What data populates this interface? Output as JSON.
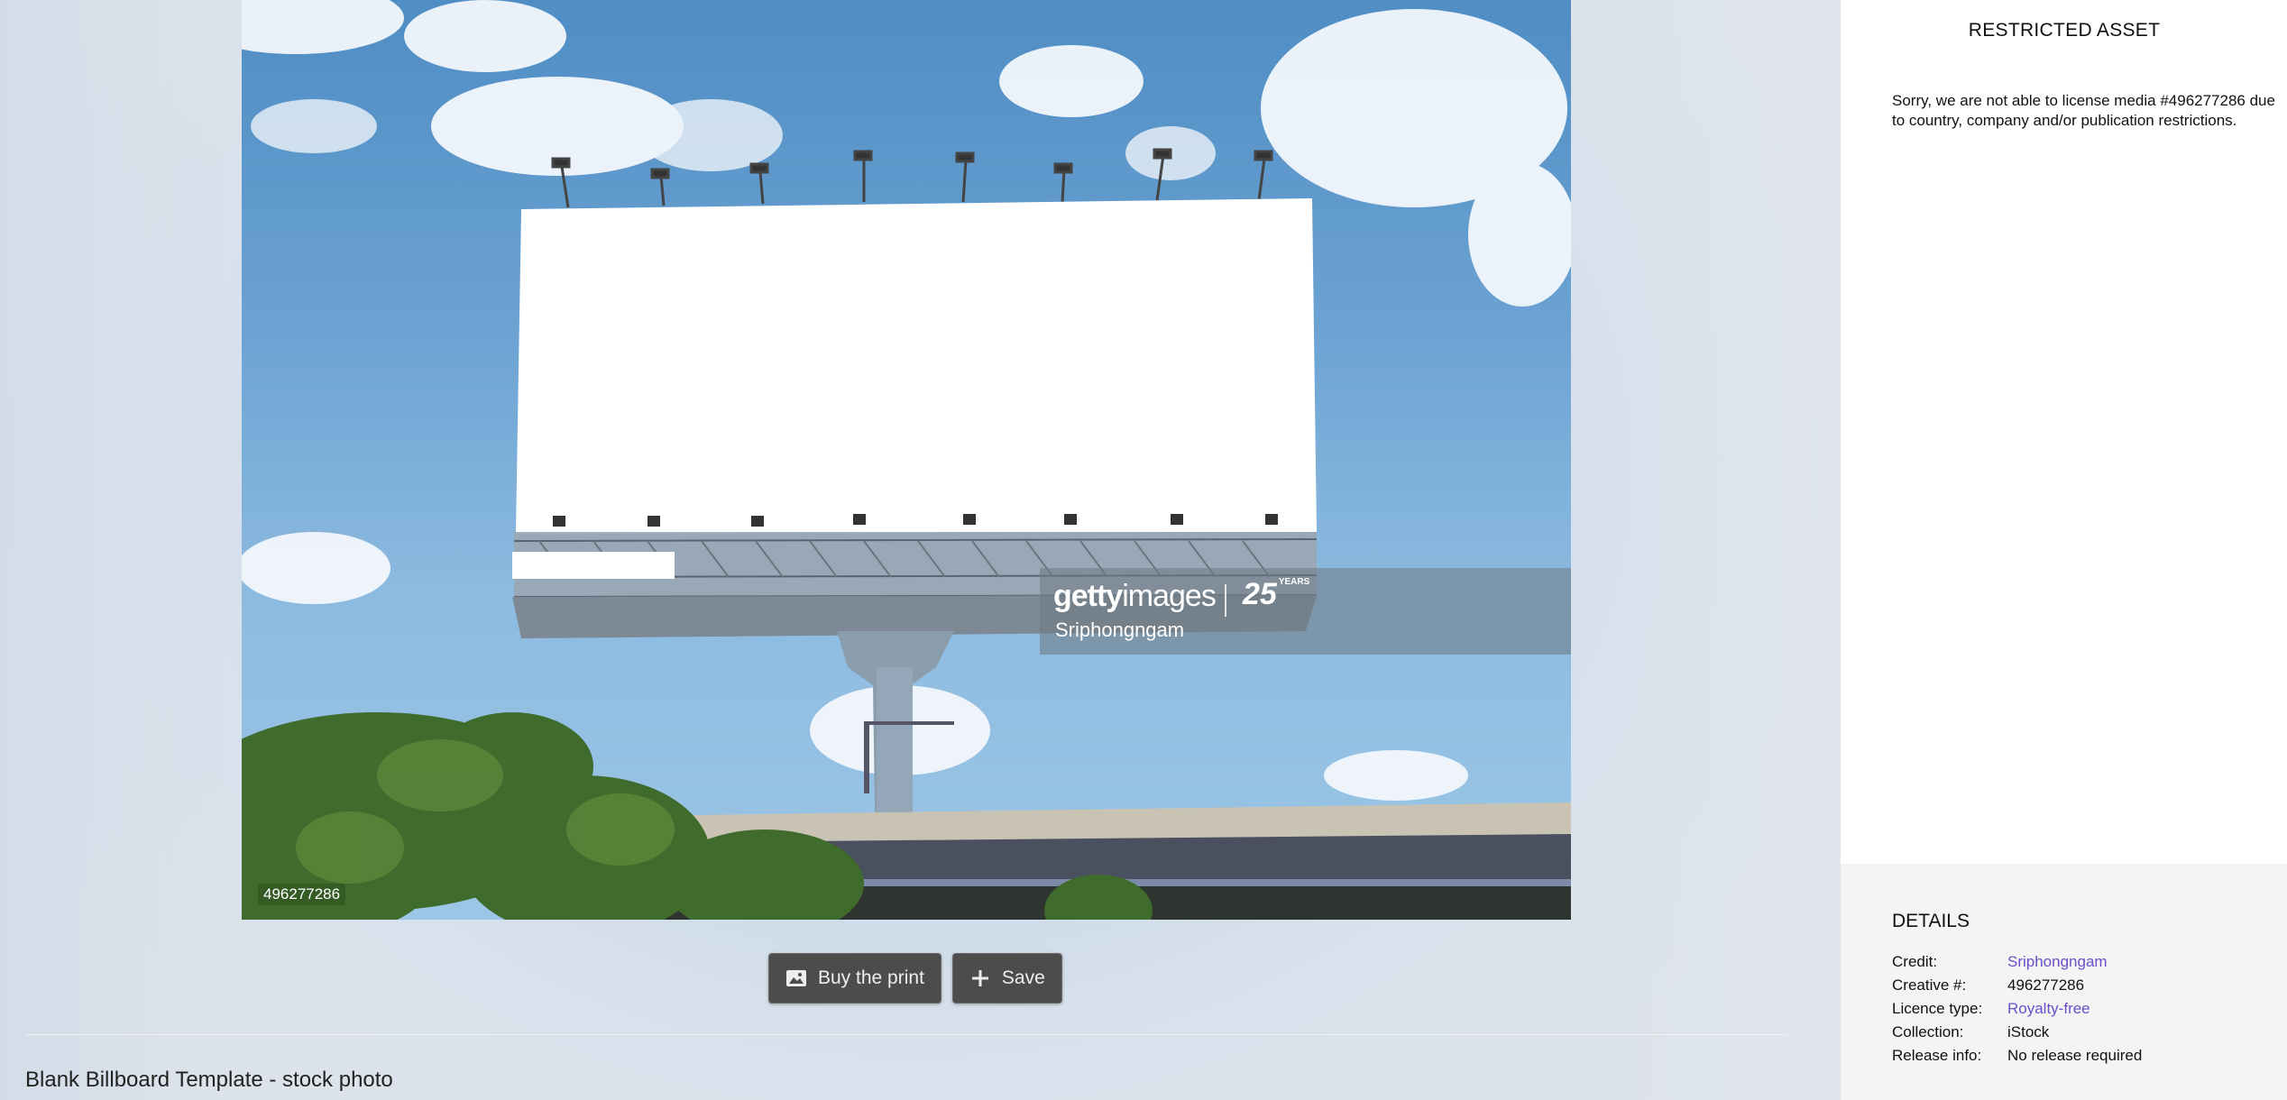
{
  "photo": {
    "asset_id_tag": "496277286",
    "watermark": {
      "brand_bold": "getty",
      "brand_light": "images",
      "anniversary": "25",
      "anniversary_suffix": "YEARS",
      "credit": "Sriphongngam"
    }
  },
  "actions": {
    "buy_print_label": "Buy the print",
    "save_label": "Save",
    "buy_print_icon": "image-icon",
    "save_icon": "plus-icon"
  },
  "photo_title": "Blank Billboard Template - stock photo",
  "panel": {
    "header": "RESTRICTED ASSET",
    "message": "Sorry, we are not able to license media #496277286 due to country, company and/or publication restrictions."
  },
  "details": {
    "title": "DETAILS",
    "rows": [
      {
        "label": "Credit:",
        "value": "Sriphongngam",
        "link": true
      },
      {
        "label": "Creative #:",
        "value": "496277286",
        "link": false
      },
      {
        "label": "Licence type:",
        "value": "Royalty-free",
        "link": true
      },
      {
        "label": "Collection:",
        "value": "iStock",
        "link": false
      },
      {
        "label": "Release info:",
        "value": "No release required",
        "link": false
      }
    ]
  },
  "colors": {
    "link": "#6a4fc8",
    "button_bg": "#4c4c4c",
    "panel_details_bg": "#f4f4f4"
  }
}
